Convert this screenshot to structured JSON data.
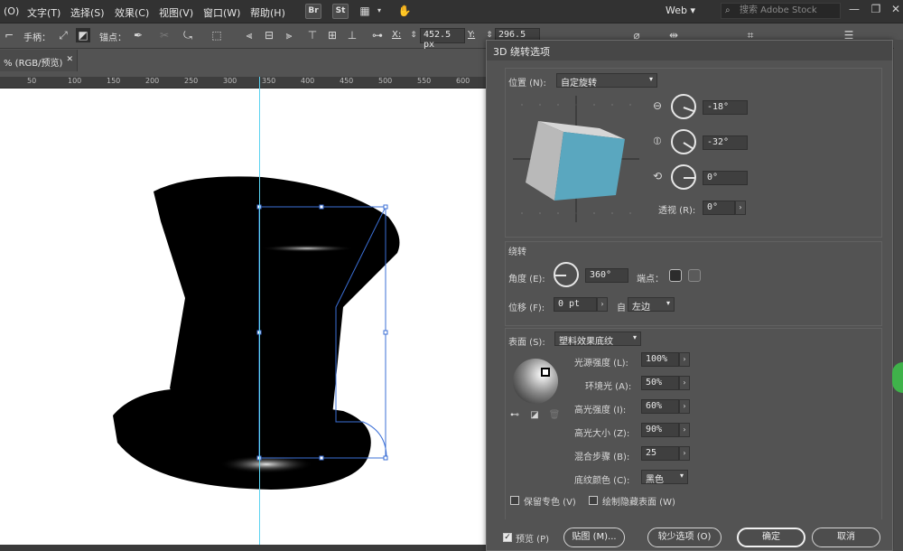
{
  "menubar": {
    "items": [
      "(O)",
      "文字(T)",
      "选择(S)",
      "效果(C)",
      "视图(V)",
      "窗口(W)",
      "帮助(H)"
    ],
    "app_icons": [
      "Br",
      "St"
    ],
    "workspace": "Web",
    "stock_placeholder": "搜索 Adobe Stock"
  },
  "controlbar": {
    "handle_label": "手柄：",
    "anchor_label": "锚点：",
    "x_label": "X:",
    "x_value": "452.5 px",
    "y_label": "Y:",
    "y_value": "296.5 px"
  },
  "document": {
    "tab_label": "% (RGB/预览)",
    "close_glyph": "✕",
    "ruler_ticks": [
      "50",
      "100",
      "150",
      "200",
      "250",
      "300",
      "350",
      "400",
      "450",
      "500",
      "550",
      "600"
    ]
  },
  "dialog": {
    "title": "3D 绕转选项",
    "position": {
      "label": "位置 (N):",
      "preset": "自定旋转",
      "x_rotation": "-18°",
      "y_rotation": "-32°",
      "z_rotation": "0°",
      "perspective_label": "透视 (R):",
      "perspective_value": "0°"
    },
    "revolve": {
      "heading": "绕转",
      "angle_label": "角度 (E):",
      "angle_value": "360°",
      "cap_label": "端点：",
      "offset_label": "位移 (F):",
      "offset_value": "0 pt",
      "from_label": "自",
      "from_value": "左边"
    },
    "surface": {
      "label": "表面 (S):",
      "value": "塑料效果底纹",
      "light_intensity_label": "光源强度 (L):",
      "light_intensity": "100%",
      "ambient_label": "环境光 (A):",
      "ambient": "50%",
      "highlight_intensity_label": "高光强度 (I):",
      "highlight_intensity": "60%",
      "highlight_size_label": "高光大小 (Z):",
      "highlight_size": "90%",
      "blend_steps_label": "混合步骤 (B):",
      "blend_steps": "25",
      "shading_color_label": "底纹颜色 (C):",
      "shading_color": "黑色"
    },
    "checkboxes": {
      "preserve_spot": "保留专色 (V)",
      "draw_hidden": "绘制隐藏表面 (W)"
    },
    "footer": {
      "preview_label": "预览 (P)",
      "map_art_button": "贴图 (M)...",
      "fewer_options_button": "较少选项 (O)",
      "ok_button": "确定",
      "cancel_button": "取消"
    }
  },
  "colors": {
    "cube_front": "#5aa7bf",
    "cube_side": "#b9b9b9",
    "cube_top": "#d6d6d6",
    "guide": "#5ad2f0",
    "selection": "#3b6fd6"
  }
}
